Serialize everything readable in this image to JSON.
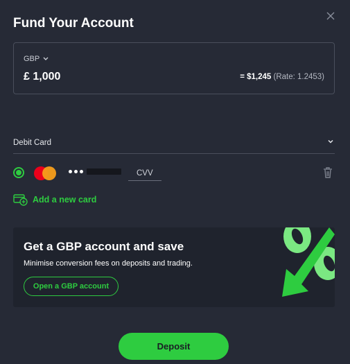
{
  "dialog": {
    "title": "Fund Your Account",
    "close_icon": "close-icon"
  },
  "amount": {
    "currency": "GBP",
    "value": "£ 1,000",
    "converted": "= $1,245",
    "rate": "(Rate: 1.2453)"
  },
  "payment_method": {
    "label": "Debit Card",
    "selected_card": {
      "brand_icon": "mastercard-logo",
      "masked_dots": "•••",
      "cvv_placeholder": "CVV",
      "selected": true
    },
    "add_card_label": "Add a new card"
  },
  "promo": {
    "title": "Get a GBP account and save",
    "subtitle": "Minimise conversion fees on deposits and trading.",
    "button_label": "Open a GBP account"
  },
  "deposit_label": "Deposit",
  "colors": {
    "background": "#262a36",
    "accent": "#2ecc40",
    "promo_background": "#1f232d"
  }
}
